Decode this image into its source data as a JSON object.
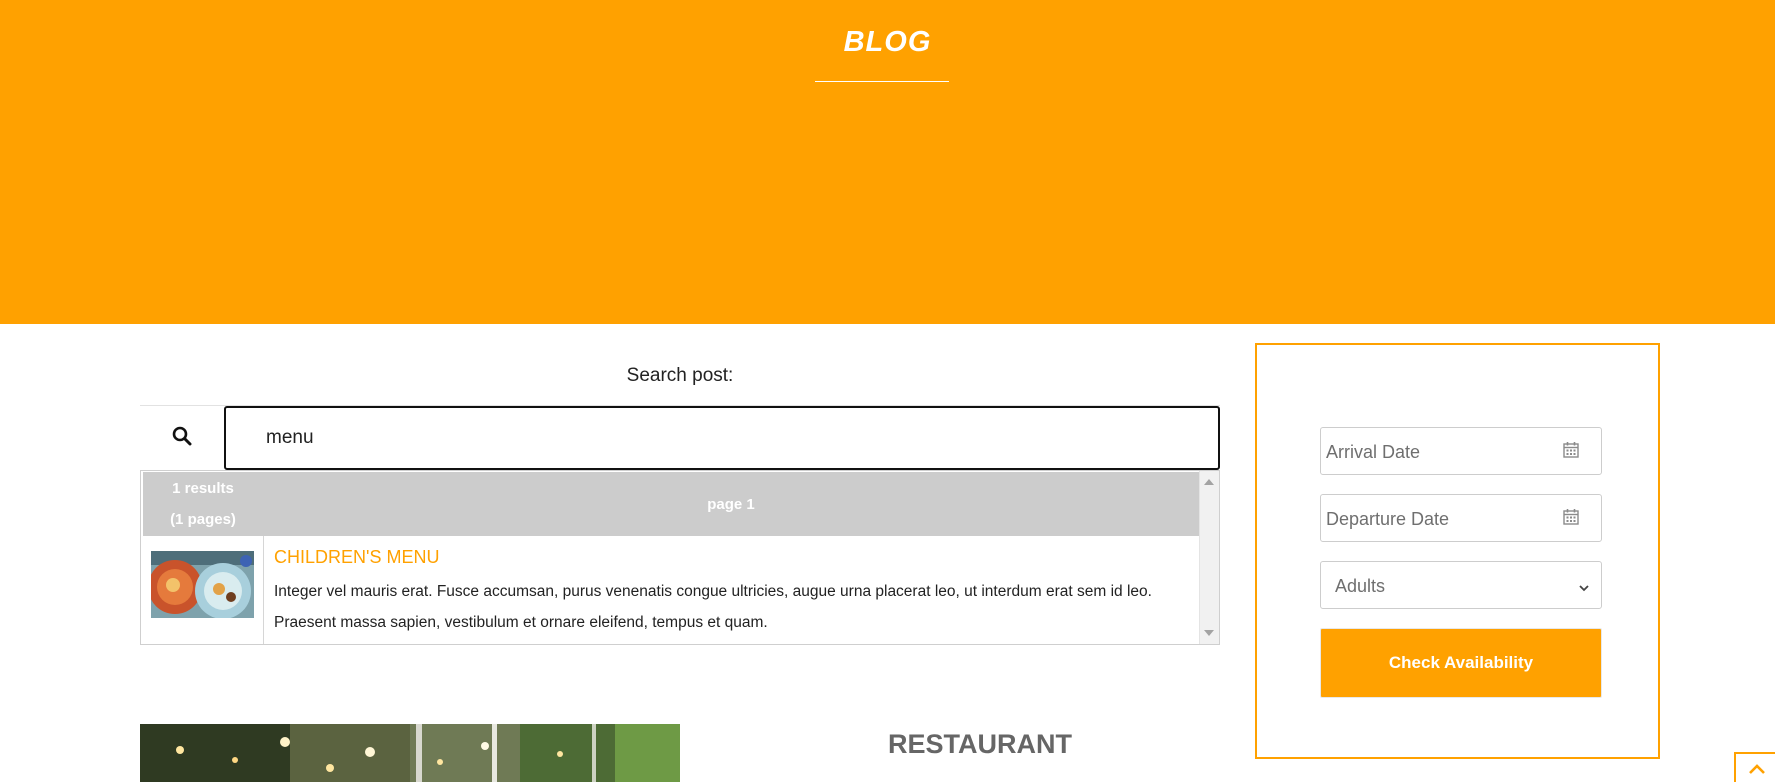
{
  "hero": {
    "title": "BLOG"
  },
  "search": {
    "label": "Search post:",
    "value": "menu",
    "icon": "search-icon"
  },
  "results": {
    "count": "1 results",
    "pages": "(1 pages)",
    "page": "page 1",
    "items": [
      {
        "title": "CHILDREN'S MENU",
        "excerpt": "Integer vel mauris erat. Fusce accumsan, purus venenatis congue ultricies, augue urna placerat leo, ut interdum erat sem id leo. Praesent massa sapien, vestibulum et ornare eleifend, tempus et quam."
      }
    ]
  },
  "section": {
    "title": "RESTAURANT"
  },
  "booking": {
    "arrival_placeholder": "Arrival Date",
    "departure_placeholder": "Departure Date",
    "adults_selected": "Adults",
    "check_label": "Check Availability",
    "calendar_icon": "calendar-icon",
    "chevron_icon": "chevron-down-icon"
  },
  "colors": {
    "accent": "#ffa100",
    "header_grey": "#cccccc",
    "heading_grey": "#666666"
  }
}
